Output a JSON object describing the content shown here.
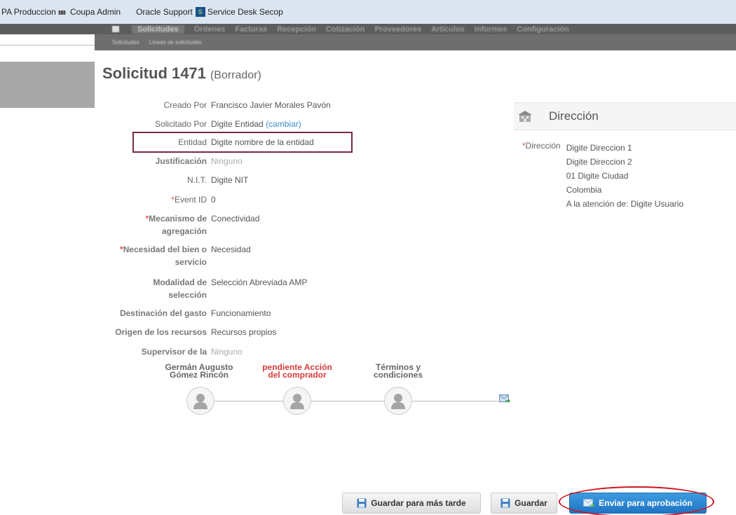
{
  "bookmarks": [
    {
      "label": "PA Produccion",
      "icon": "bars-icon"
    },
    {
      "label": "Coupa Admin",
      "icon": ""
    },
    {
      "label": "Oracle Support",
      "icon": ""
    },
    {
      "label": "Service Desk Secop",
      "icon": "service-desk-icon"
    }
  ],
  "nav": {
    "tabs": [
      "Solicitudes",
      "Órdenes",
      "Facturas",
      "Recepción",
      "Cotización",
      "Proveedores",
      "Artículos",
      "Informes",
      "Configuración"
    ],
    "subtabs": [
      "Solicitudes",
      "Líneas de solicitudes"
    ]
  },
  "page": {
    "title": "Solicitud 1471",
    "status": "(Borrador)"
  },
  "form": {
    "creado_por": {
      "label": "Creado Por",
      "value": "Francisco Javier Morales Pavón"
    },
    "solicitado_por": {
      "label": "Solicitado Por",
      "value": "Digite Entidad",
      "link": "(cambiar)"
    },
    "entidad": {
      "label": "Entidad",
      "value": "Digite nombre de la entidad"
    },
    "justificacion": {
      "label": "Justificación",
      "value": "Ninguno"
    },
    "nit": {
      "label": "N.I.T.",
      "value": "Digite NIT"
    },
    "event_id": {
      "label": "Event ID",
      "value": "0"
    },
    "mecanismo_l1": "Mecanismo de",
    "mecanismo_l2": "agregación",
    "mecanismo_value": "Conectividad",
    "necesidad_l1": "Necesidad del bien o",
    "necesidad_l2": "servicio",
    "necesidad_value": "Necesidad",
    "modalidad_l1": "Modalidad de",
    "modalidad_l2": "selección",
    "modalidad_value": "Selección Abreviada AMP",
    "destinacion": {
      "label": "Destinación del gasto",
      "value": "Funcionamiento"
    },
    "origen": {
      "label": "Origen de los recursos",
      "value": "Recursos propios"
    },
    "supervisor": {
      "label": "Supervisor de la",
      "value": "Ninguno"
    },
    "required_mark": "*"
  },
  "address": {
    "header": "Dirección",
    "label": "Dirección",
    "lines": [
      "Digite Direccion 1",
      "Digite Direccion 2",
      "01 Digite Ciudad",
      "Colombia",
      "A la atención de: Digite Usuario"
    ]
  },
  "approval_chain": [
    {
      "line1": "Germán Augusto",
      "line2": "Gómez Rincón"
    },
    {
      "line1": "pendiente Acción",
      "line2": "del comprador"
    },
    {
      "line1": "Términos y",
      "line2": "condiciones"
    }
  ],
  "buttons": {
    "save_later": "Guardar para más tarde",
    "save": "Guardar",
    "submit": "Enviar para aprobación"
  },
  "colors": {
    "highlight_box": "#7a2946",
    "annotation_oval": "#d0151b",
    "primary_button": "#2a86d2",
    "pending_text": "#d53b3b"
  }
}
